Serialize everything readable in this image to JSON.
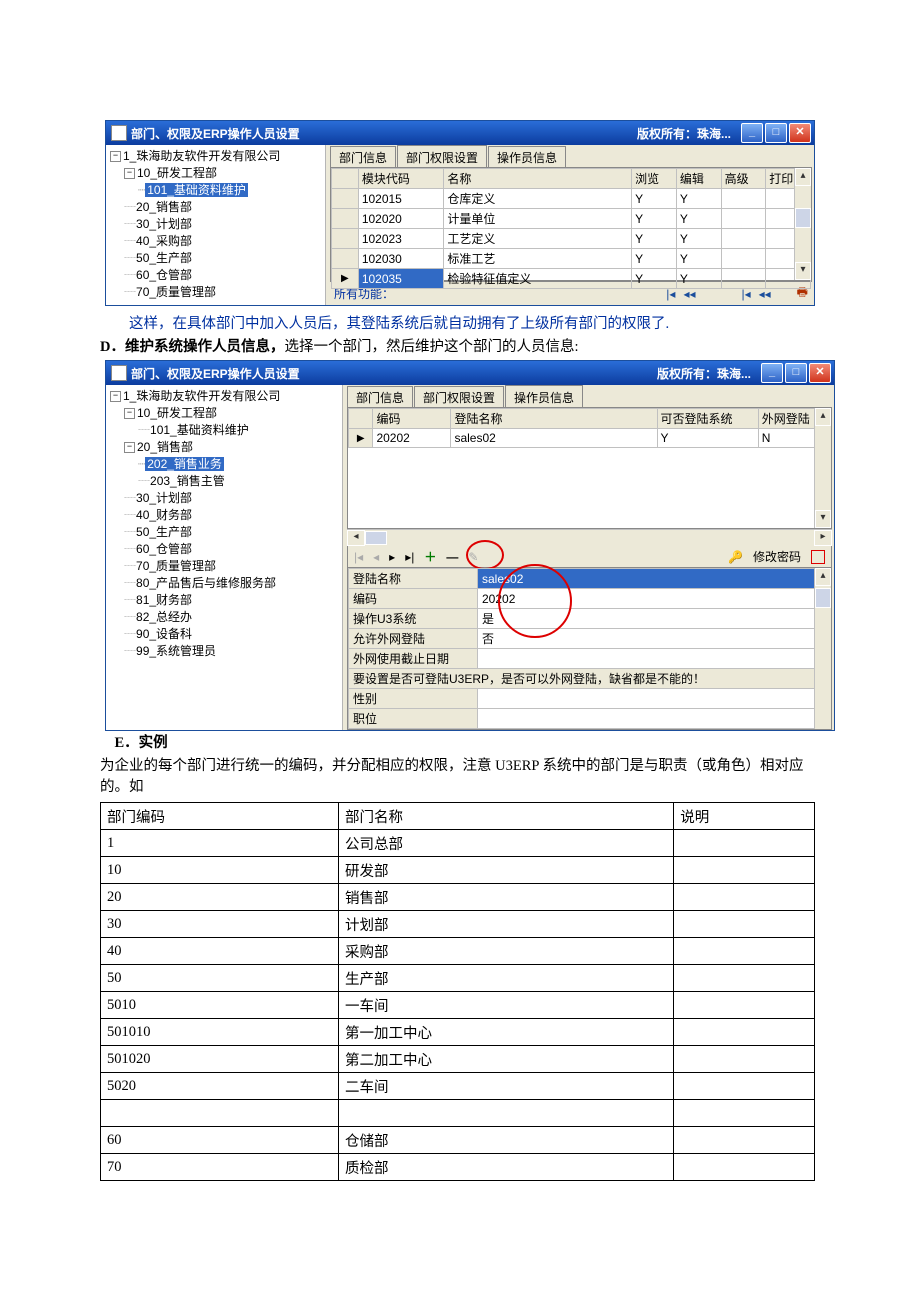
{
  "win1": {
    "title": "部门、权限及ERP操作人员设置",
    "copyright": "版权所有：珠海...",
    "tree": [
      {
        "exp": "−",
        "label": "1_珠海助友软件开发有限公司",
        "children": [
          {
            "exp": "−",
            "label": "10_研发工程部",
            "children": [
              {
                "label": "101_基础资料维护",
                "sel": true
              }
            ]
          },
          {
            "label": "20_销售部"
          },
          {
            "label": "30_计划部"
          },
          {
            "label": "40_采购部"
          },
          {
            "label": "50_生产部"
          },
          {
            "label": "60_仓管部"
          },
          {
            "label": "70_质量管理部"
          }
        ]
      }
    ],
    "tabs": [
      "部门信息",
      "部门权限设置",
      "操作员信息"
    ],
    "active_tab": 1,
    "cols": [
      "模块代码",
      "名称",
      "浏览",
      "编辑",
      "高级",
      "打印"
    ],
    "rows": [
      [
        "",
        "102015",
        "仓库定义",
        "Y",
        "Y",
        "",
        ""
      ],
      [
        "",
        "102020",
        "计量单位",
        "Y",
        "Y",
        "",
        ""
      ],
      [
        "",
        "102023",
        "工艺定义",
        "Y",
        "Y",
        "",
        ""
      ],
      [
        "",
        "102030",
        "标准工艺",
        "Y",
        "Y",
        "",
        ""
      ],
      [
        "▶",
        "102035",
        "检验特征值定义",
        "Y",
        "Y",
        "",
        ""
      ]
    ],
    "footer_label": "所有功能："
  },
  "para_blue": "这样，在具体部门中加入人员后，其登陆系统后就自动拥有了上级所有部门的权限了.",
  "para_d_bold": "D．维护系统操作人员信息，",
  "para_d_rest": "选择一个部门，然后维护这个部门的人员信息:",
  "win2": {
    "title": "部门、权限及ERP操作人员设置",
    "copyright": "版权所有：珠海...",
    "tree": [
      {
        "exp": "−",
        "label": "1_珠海助友软件开发有限公司",
        "children": [
          {
            "exp": "−",
            "label": "10_研发工程部",
            "children": [
              {
                "label": "101_基础资料维护"
              }
            ]
          },
          {
            "exp": "−",
            "label": "20_销售部",
            "children": [
              {
                "label": "202_销售业务",
                "sel": true
              },
              {
                "label": "203_销售主管"
              }
            ]
          },
          {
            "label": "30_计划部"
          },
          {
            "label": "40_财务部"
          },
          {
            "label": "50_生产部"
          },
          {
            "label": "60_仓管部"
          },
          {
            "label": "70_质量管理部"
          },
          {
            "label": "80_产品售后与维修服务部"
          },
          {
            "label": "81_财务部"
          },
          {
            "label": "82_总经办"
          },
          {
            "label": "90_设备科"
          },
          {
            "label": "99_系统管理员"
          }
        ]
      }
    ],
    "tabs": [
      "部门信息",
      "部门权限设置",
      "操作员信息"
    ],
    "active_tab": 2,
    "cols": [
      "编码",
      "登陆名称",
      "可否登陆系统",
      "外网登陆"
    ],
    "rows": [
      [
        "▶",
        "20202",
        "sales02",
        "Y",
        "N"
      ]
    ],
    "passbtn": "修改密码",
    "details": [
      [
        "登陆名称",
        "sales02"
      ],
      [
        "编码",
        "20202"
      ],
      [
        "操作U3系统",
        "是"
      ],
      [
        "允许外网登陆",
        "否"
      ],
      [
        "外网使用截止日期",
        ""
      ],
      [
        "性别",
        ""
      ],
      [
        "职位",
        ""
      ]
    ],
    "hint": "要设置是否可登陆U3ERP，是否可以外网登陆，缺省都是不能的！"
  },
  "section_e": "E．实例",
  "para_e": "为企业的每个部门进行统一的编码，并分配相应的权限，注意 U3ERP 系统中的部门是与职责（或角色）相对应的。如",
  "ex_table": {
    "head": [
      "部门编码",
      "部门名称",
      "说明"
    ],
    "rows": [
      [
        "1",
        "公司总部",
        ""
      ],
      [
        "10",
        "研发部",
        ""
      ],
      [
        "20",
        "销售部",
        ""
      ],
      [
        "30",
        "计划部",
        ""
      ],
      [
        "40",
        "采购部",
        ""
      ],
      [
        "50",
        "生产部",
        ""
      ],
      [
        "5010",
        "一车间",
        ""
      ],
      [
        "501010",
        "第一加工中心",
        ""
      ],
      [
        "501020",
        "第二加工中心",
        ""
      ],
      [
        "5020",
        "二车间",
        ""
      ],
      [
        "",
        "",
        ""
      ],
      [
        "60",
        "仓储部",
        ""
      ],
      [
        "70",
        "质检部",
        ""
      ]
    ]
  }
}
